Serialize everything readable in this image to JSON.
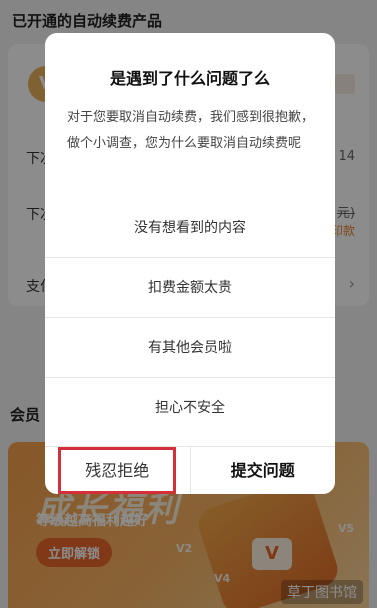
{
  "page": {
    "section_title": "已开通的自动续费产品",
    "rows": [
      {
        "label": "下次",
        "value": "14"
      },
      {
        "label": "下次",
        "value": "元)",
        "extra": "印款"
      },
      {
        "label": "支付"
      }
    ],
    "section2_title": "会员",
    "banner": {
      "title": "成长福利",
      "subtitle": "等级越高福利越好",
      "button": "立即解锁",
      "levels": [
        "V2",
        "V4",
        "V5"
      ],
      "watermark": "草丁图书馆"
    }
  },
  "dialog": {
    "title": "是遇到了什么问题了么",
    "description": "对于您要取消自动续费，我们感到很抱歉，做个小调查，您为什么要取消自动续费呢",
    "options": [
      "没有想看到的内容",
      "扣费金额太贵",
      "有其他会员啦",
      "担心不安全"
    ],
    "cancel_label": "残忍拒绝",
    "submit_label": "提交问题"
  },
  "colors": {
    "highlight": "#d4303a",
    "banner_orange": "#f6a04a",
    "mask": "rgba(0,0,0,0.45)"
  }
}
